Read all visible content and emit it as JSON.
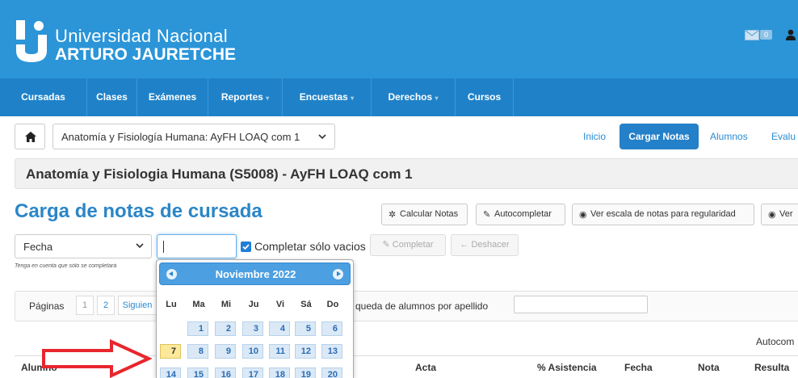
{
  "header": {
    "university_line1": "Universidad Nacional",
    "university_line2": "ARTURO JAURETCHE",
    "mail_count": "0",
    "mail_icon": "envelope-icon",
    "user_icon": "user-icon"
  },
  "nav": {
    "items": [
      "Cursadas",
      "Clases",
      "Exámenes",
      "Reportes",
      "Encuestas",
      "Derechos",
      "Cursos"
    ]
  },
  "subbar": {
    "course_select_value": "Anatomía y Fisiología Humana: AyFH LOAQ com 1",
    "links": [
      "Inicio",
      "Cargar Notas",
      "Alumnos",
      "Evalu"
    ]
  },
  "course_title": "Anatomía y Fisiologia Humana (S5008) - AyFH LOAQ com 1",
  "section": {
    "title": "Carga de notas de cursada",
    "buttons": [
      "Calcular Notas",
      "Autocompletar",
      "Ver escala de notas para regularidad",
      "Ver"
    ]
  },
  "filters": {
    "fecha_select": "Fecha",
    "date_input_value": "",
    "checkbox_label": "Completar sólo vacios",
    "checkbox_checked": true,
    "completar_label": "Completar",
    "deshacer_label": "Deshacer",
    "note": "Tenga en cuenta que sólo se completará"
  },
  "pagination": {
    "label": "Páginas",
    "pages": [
      "1",
      "2"
    ],
    "next_label": "Siguien",
    "search_label": "queda de alumnos por apellido",
    "search_value": ""
  },
  "autocomplete_label": "Autocom",
  "table": {
    "columns": [
      "Alumno",
      "Acta",
      "% Asistencia",
      "Fecha",
      "Nota",
      "Resulta"
    ]
  },
  "datepicker": {
    "month": "Noviembre",
    "year": "2022",
    "weekdays": [
      "Lu",
      "Ma",
      "Mi",
      "Ju",
      "Vi",
      "Sá",
      "Do"
    ],
    "week1": [
      "1",
      "2",
      "3",
      "4",
      "5",
      "6"
    ],
    "week2": [
      "7",
      "8",
      "9",
      "10",
      "11",
      "12",
      "13"
    ],
    "week3": [
      "14",
      "15",
      "16",
      "17",
      "18",
      "19",
      "20"
    ],
    "highlighted_day": "7"
  },
  "colors": {
    "header_bg": "#2b95d8",
    "nav_bg": "#1f82c9",
    "accent": "#2b86c7",
    "arrow": "#e8262d"
  }
}
